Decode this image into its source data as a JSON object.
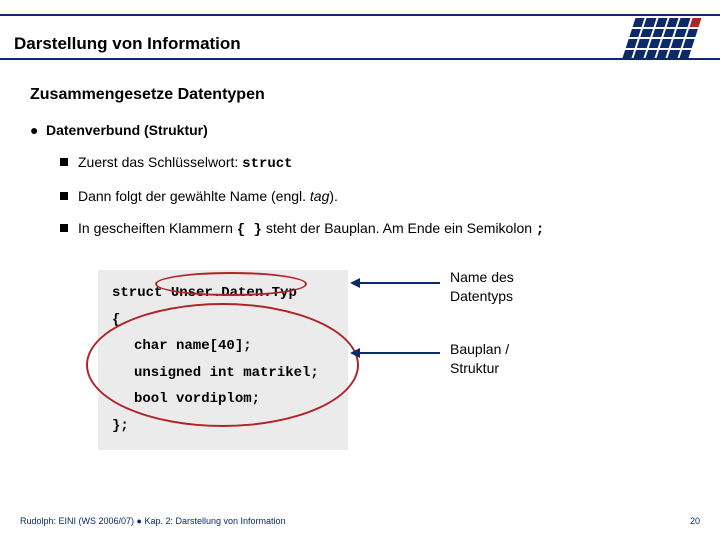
{
  "header": {
    "title": "Darstellung von Information"
  },
  "content": {
    "subtitle": "Zusammengesetze Datentypen",
    "lvl1_label": "Datenverbund (Struktur)",
    "items": {
      "i1_pre": "Zuerst das Schlüsselwort: ",
      "i1_code": "struct",
      "i2_pre": "Dann folgt der gewählte Name (engl. ",
      "i2_ital": "tag",
      "i2_post": ").",
      "i3_pre": "In gescheiften Klammern ",
      "i3_code": "{ }",
      "i3_mid": " steht der Bauplan. Am Ende ein Semikolon ",
      "i3_code2": ";"
    }
  },
  "code": {
    "l1a": "struct",
    "l1b": " Unser.Daten.Typ",
    "l2": "{",
    "l3": "char name[40];",
    "l4": "unsigned int matrikel;",
    "l5": "bool vordiplom;",
    "l6": "};"
  },
  "annot": {
    "a1l1": "Name des",
    "a1l2": "Datentyps",
    "a2l1": "Bauplan /",
    "a2l2": "Struktur"
  },
  "footer": {
    "left": "Rudolph: EINI (WS 2006/07)  ●  Kap. 2: Darstellung von Information",
    "right": "20"
  }
}
